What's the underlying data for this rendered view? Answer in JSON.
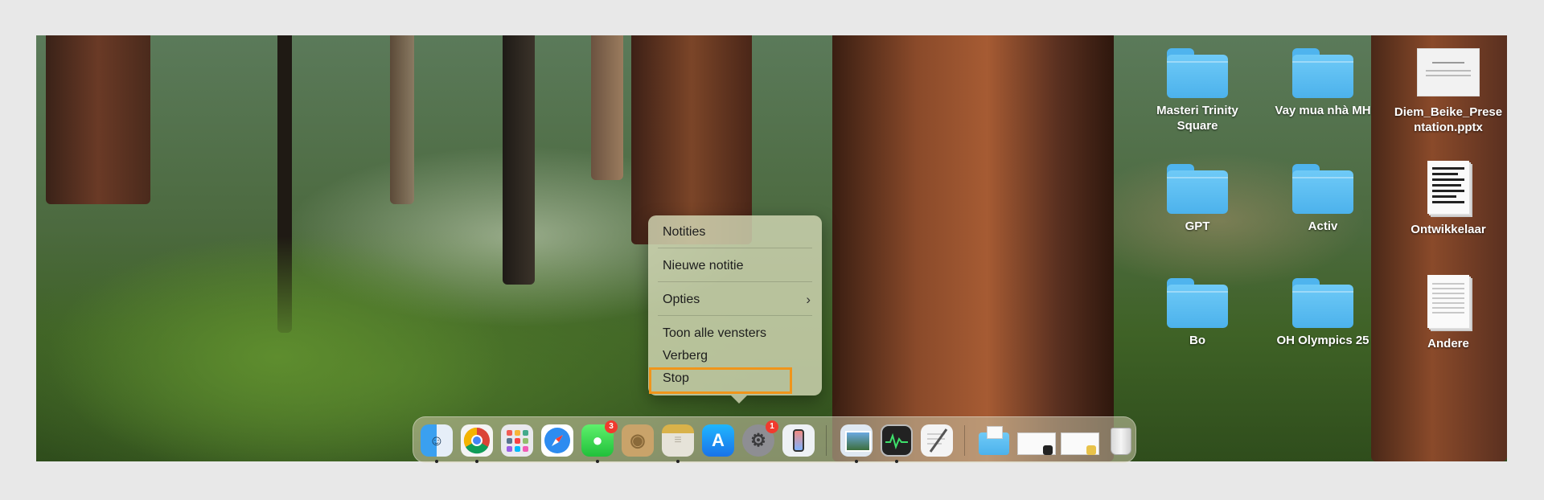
{
  "desktop": {
    "icons": [
      {
        "label": "Masteri Trinity Square",
        "icon": "folder-icon"
      },
      {
        "label": "Vay mua nhà MH",
        "icon": "folder-icon"
      },
      {
        "label": "Diem_Beike_Presentation.pptx",
        "icon": "document-icon"
      },
      {
        "label": "GPT",
        "icon": "folder-icon"
      },
      {
        "label": "Activ",
        "icon": "folder-icon"
      },
      {
        "label": "Ontwikkelaar",
        "icon": "document-icon"
      },
      {
        "label": "Bo",
        "icon": "folder-icon"
      },
      {
        "label": "OH Olympics 25",
        "icon": "folder-icon"
      },
      {
        "label": "Andere",
        "icon": "document-icon"
      }
    ],
    "icon_lines": {
      "masteri": [
        "Masteri Trinity",
        "Square"
      ],
      "pptx": [
        "Diem_Beike_Prese",
        "ntation.pptx"
      ]
    }
  },
  "context_menu": {
    "app_name": "Notities",
    "new_note": "Nieuwe notitie",
    "options": "Opties",
    "show_all_windows": "Toon alle vensters",
    "hide": "Verberg",
    "quit": "Stop",
    "options_chevron": "›",
    "highlight_color": "#f0951b"
  },
  "dock": {
    "apps": [
      {
        "name": "Finder",
        "icon": "finder-icon",
        "running": true
      },
      {
        "name": "Google Chrome",
        "icon": "chrome-icon",
        "running": true
      },
      {
        "name": "Launchpad",
        "icon": "launchpad-icon",
        "running": false
      },
      {
        "name": "Safari",
        "icon": "safari-icon",
        "running": false
      },
      {
        "name": "Berichten",
        "icon": "messages-icon",
        "running": true,
        "badge": "3"
      },
      {
        "name": "Contacten",
        "icon": "contacts-icon",
        "running": false
      },
      {
        "name": "Notities",
        "icon": "notes-icon",
        "running": true
      },
      {
        "name": "App Store",
        "icon": "app-store-icon",
        "running": false
      },
      {
        "name": "Systeeminstellingen",
        "icon": "settings-icon",
        "running": false,
        "badge": "1"
      },
      {
        "name": "iPhone-synchronisatie",
        "icon": "iphone-mirroring-icon",
        "running": false
      },
      {
        "name": "Voorvertoning",
        "icon": "preview-icon",
        "running": true
      },
      {
        "name": "Activiteitenweergave",
        "icon": "activity-monitor-icon",
        "running": true
      },
      {
        "name": "Teksteditor",
        "icon": "textedit-icon",
        "running": false
      },
      {
        "name": "Downloads",
        "icon": "downloads-folder-icon",
        "running": false
      },
      {
        "name": "Venster 1",
        "icon": "minimized-window-icon",
        "running": false
      },
      {
        "name": "Venster 2",
        "icon": "minimized-window-icon",
        "running": false
      },
      {
        "name": "Prullenmand",
        "icon": "trash-icon",
        "running": false
      }
    ]
  }
}
